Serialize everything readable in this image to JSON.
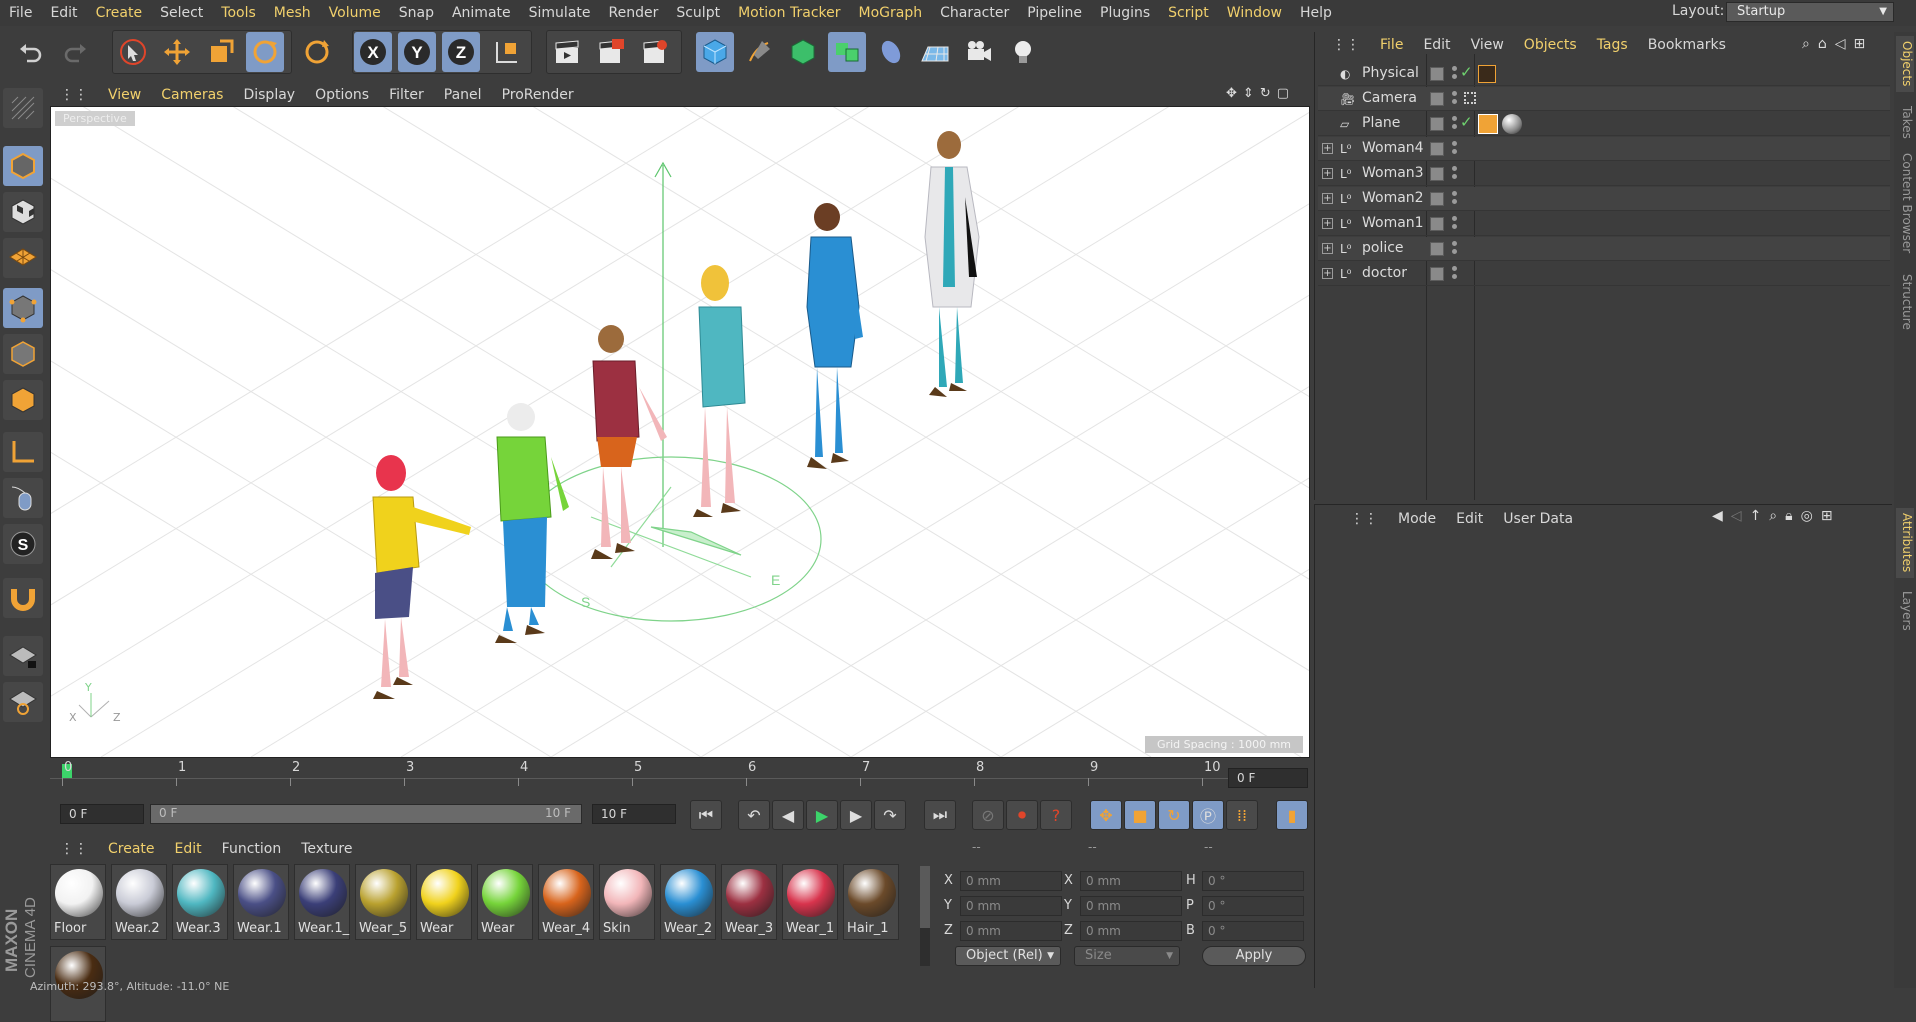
{
  "menubar": {
    "items": [
      {
        "label": "File",
        "hl": false
      },
      {
        "label": "Edit",
        "hl": false
      },
      {
        "label": "Create",
        "hl": true
      },
      {
        "label": "Select",
        "hl": false
      },
      {
        "label": "Tools",
        "hl": true
      },
      {
        "label": "Mesh",
        "hl": true
      },
      {
        "label": "Volume",
        "hl": true
      },
      {
        "label": "Snap",
        "hl": false
      },
      {
        "label": "Animate",
        "hl": false
      },
      {
        "label": "Simulate",
        "hl": false
      },
      {
        "label": "Render",
        "hl": false
      },
      {
        "label": "Sculpt",
        "hl": false
      },
      {
        "label": "Motion Tracker",
        "hl": true
      },
      {
        "label": "MoGraph",
        "hl": true
      },
      {
        "label": "Character",
        "hl": false
      },
      {
        "label": "Pipeline",
        "hl": false
      },
      {
        "label": "Plugins",
        "hl": false
      },
      {
        "label": "Script",
        "hl": true
      },
      {
        "label": "Window",
        "hl": true
      },
      {
        "label": "Help",
        "hl": false
      }
    ],
    "layout_label": "Layout:",
    "layout_value": "Startup"
  },
  "viewport": {
    "menu": [
      {
        "label": "View",
        "hl": true
      },
      {
        "label": "Cameras",
        "hl": true
      },
      {
        "label": "Display",
        "hl": false
      },
      {
        "label": "Options",
        "hl": false
      },
      {
        "label": "Filter",
        "hl": false
      },
      {
        "label": "Panel",
        "hl": false
      },
      {
        "label": "ProRender",
        "hl": false
      }
    ],
    "label": "Perspective",
    "grid_spacing": "Grid Spacing : 1000 mm",
    "axis_x": "X",
    "axis_y": "Y",
    "axis_z": "Z"
  },
  "timeline": {
    "ticks": [
      "0",
      "1",
      "2",
      "3",
      "4",
      "5",
      "6",
      "7",
      "8",
      "9",
      "10"
    ],
    "current_frame": "0 F",
    "start_frame": "0 F",
    "range_start": "0 F",
    "range_end": "10 F",
    "end_frame": "10 F"
  },
  "materials": {
    "menu": [
      {
        "label": "Create",
        "hl": true
      },
      {
        "label": "Edit",
        "hl": true
      },
      {
        "label": "Function",
        "hl": false
      },
      {
        "label": "Texture",
        "hl": false
      }
    ],
    "items": [
      {
        "label": "Floor",
        "color": "#f2f2f2"
      },
      {
        "label": "Wear.2",
        "color": "#c9cbd6"
      },
      {
        "label": "Wear.3",
        "color": "#4fb7c1"
      },
      {
        "label": "Wear.1",
        "color": "#4a4f86"
      },
      {
        "label": "Wear.1_",
        "color": "#3b3f78"
      },
      {
        "label": "Wear_5",
        "color": "#b9a12f"
      },
      {
        "label": "Wear",
        "color": "#f0d21c"
      },
      {
        "label": "Wear",
        "color": "#76d43a"
      },
      {
        "label": "Wear_4",
        "color": "#d8641c"
      },
      {
        "label": "Skin",
        "color": "#f2b6b9"
      },
      {
        "label": "Wear_2",
        "color": "#2a8fd3"
      },
      {
        "label": "Wear_3",
        "color": "#9c3041"
      },
      {
        "label": "Wear_1",
        "color": "#d8344d"
      },
      {
        "label": "Hair_1",
        "color": "#6b4a2a"
      },
      {
        "label": "",
        "color": "#4a2c12"
      }
    ]
  },
  "coords": {
    "headers": [
      "--",
      "--",
      "--"
    ],
    "rows": [
      {
        "a1": "X",
        "v1": "0 mm",
        "a2": "X",
        "v2": "0 mm",
        "a3": "H",
        "v3": "0 °"
      },
      {
        "a1": "Y",
        "v1": "0 mm",
        "a2": "Y",
        "v2": "0 mm",
        "a3": "P",
        "v3": "0 °"
      },
      {
        "a1": "Z",
        "v1": "0 mm",
        "a2": "Z",
        "v2": "0 mm",
        "a3": "B",
        "v3": "0 °"
      }
    ],
    "mode": "Object (Rel)",
    "size": "Size",
    "apply": "Apply"
  },
  "objects": {
    "menu": [
      {
        "label": "File",
        "hl": true
      },
      {
        "label": "Edit",
        "hl": false
      },
      {
        "label": "View",
        "hl": false
      },
      {
        "label": "Objects",
        "hl": true
      },
      {
        "label": "Tags",
        "hl": true
      },
      {
        "label": "Bookmarks",
        "hl": false
      }
    ],
    "items": [
      {
        "label": "Physical Sky",
        "icon": "sky-icon",
        "expand": false,
        "check": true
      },
      {
        "label": "Camera",
        "icon": "camera-icon",
        "expand": false,
        "check": false
      },
      {
        "label": "Plane",
        "icon": "plane-icon",
        "expand": false,
        "check": true
      },
      {
        "label": "Woman4",
        "icon": "null-icon",
        "expand": true,
        "check": false
      },
      {
        "label": "Woman3",
        "icon": "null-icon",
        "expand": true,
        "check": false
      },
      {
        "label": "Woman2",
        "icon": "null-icon",
        "expand": true,
        "check": false
      },
      {
        "label": "Woman1",
        "icon": "null-icon",
        "expand": true,
        "check": false
      },
      {
        "label": "police",
        "icon": "null-icon",
        "expand": true,
        "check": false
      },
      {
        "label": "doctor",
        "icon": "null-icon",
        "expand": true,
        "check": false
      }
    ]
  },
  "attributes": {
    "menu": [
      "Mode",
      "Edit",
      "User Data"
    ]
  },
  "side_tabs": {
    "top": [
      "Objects",
      "Takes",
      "Content Browser",
      "Structure"
    ],
    "bottom": [
      "Attributes",
      "Layers"
    ]
  },
  "status": "Azimuth: 293.8°, Altitude: -11.0°  NE",
  "brand": {
    "line1": "MAXON",
    "line2": "CINEMA 4D"
  }
}
